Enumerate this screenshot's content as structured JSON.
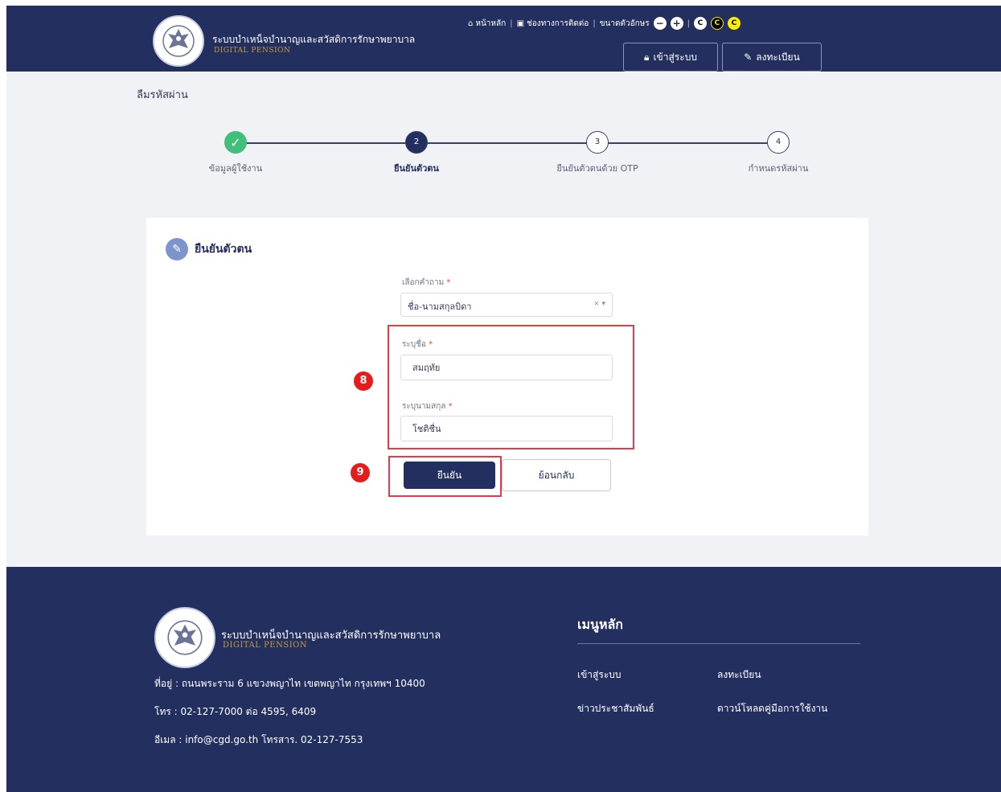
{
  "header": {
    "brand_th": "ระบบบำเหน็จบำนาญและสวัสดิการรักษาพยาบาล",
    "brand_en": "DIGITAL PENSION",
    "topnav": {
      "home": "หน้าหลัก",
      "contact": "ช่องทางการติดต่อ",
      "font_size": "ขนาดตัวอักษร"
    },
    "login_label": "เข้าสู่ระบบ",
    "register_label": "ลงทะเบียน"
  },
  "page_title": "ลืมรหัสผ่าน",
  "stepper": [
    {
      "number": "✓",
      "label": "ข้อมูลผู้ใช้งาน",
      "state": "done"
    },
    {
      "number": "2",
      "label": "ยืนยันตัวตน",
      "state": "active"
    },
    {
      "number": "3",
      "label": "ยืนยันตัวตนด้วย OTP",
      "state": "pending"
    },
    {
      "number": "4",
      "label": "กำหนดรหัสผ่าน",
      "state": "pending"
    }
  ],
  "card": {
    "title": "ยืนยันตัวตน",
    "select_label": "เลือกคำถาม",
    "select_value": "ชื่อ-นามสกุลบิดา",
    "first_name_label": "ระบุชื่อ",
    "first_name_value": "สมฤทัย",
    "last_name_label": "ระบุนามสกุล",
    "last_name_value": "โชติชื่น",
    "confirm_label": "ยืนยัน",
    "back_label": "ย้อนกลับ",
    "required_mark": "*"
  },
  "annotations": {
    "badge_8": "8",
    "badge_9": "9"
  },
  "footer": {
    "brand_th": "ระบบบำเหน็จบำนาญและสวัสดิการรักษาพยาบาล",
    "brand_en": "DIGITAL PENSION",
    "address": "ที่อยู่ : ถนนพระราม 6 แขวงพญาไท เขตพญาไท กรุงเทพฯ 10400",
    "phone": "โทร : 02-127-7000 ต่อ 4595, 6409",
    "email": "อีเมล : info@cgd.go.th โทรสาร. 02-127-7553",
    "menu_title": "เมนูหลัก",
    "menu": {
      "login": "เข้าสู่ระบบ",
      "register": "ลงทะเบียน",
      "news": "ข่าวประชาสัมพันธ์",
      "manual": "ดาวน์โหลดคู่มือการใช้งาน"
    }
  },
  "colors": {
    "navy": "#23305f",
    "success": "#40c07b",
    "highlight": "#e13c4a",
    "gold": "#c99a3c"
  }
}
